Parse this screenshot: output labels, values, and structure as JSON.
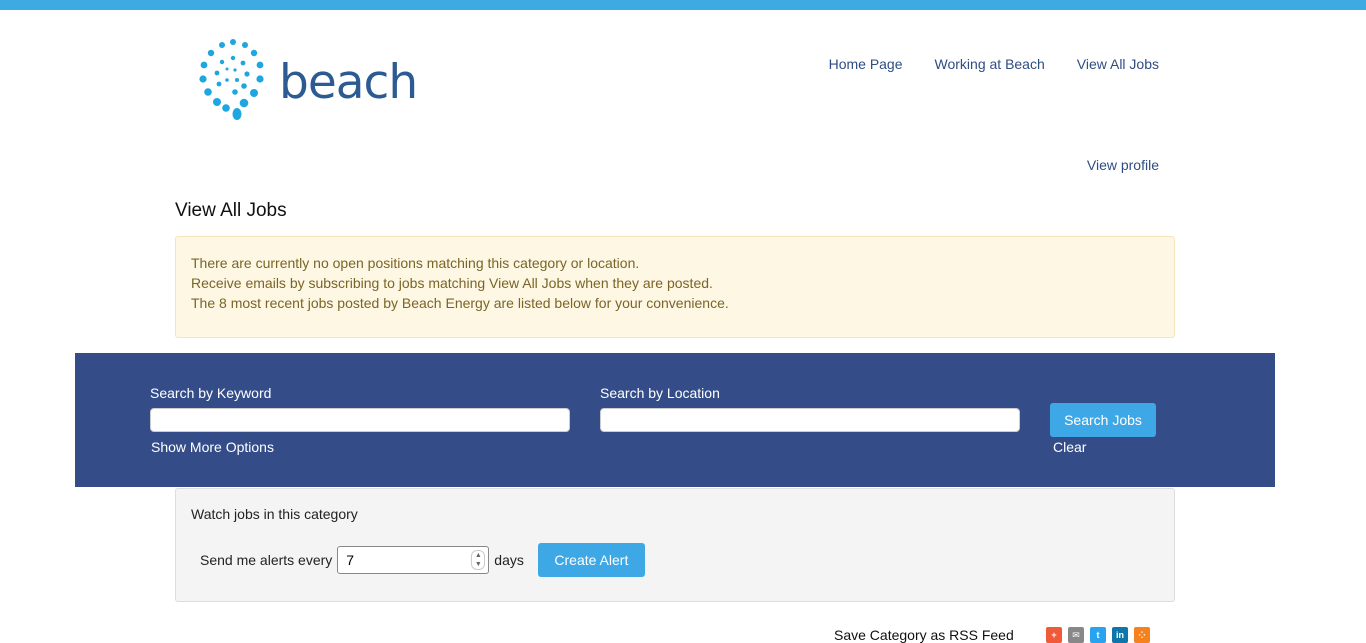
{
  "brand": {
    "name": "beach",
    "colors": {
      "top_bar": "#3daae4",
      "logo_text": "#2b5b92",
      "logo_mark": "#1da6e0",
      "search_band": "#344d89",
      "button": "#3da8e5",
      "notice_bg": "#fdf7e3",
      "notice_text": "#7a6528"
    }
  },
  "nav": {
    "items": [
      {
        "label": "Home Page"
      },
      {
        "label": "Working at Beach"
      },
      {
        "label": "View All Jobs"
      }
    ],
    "view_profile": "View profile"
  },
  "page": {
    "title": "View All Jobs",
    "notice_lines": [
      "There are currently no open positions matching this category or location.",
      "Receive emails by subscribing to jobs matching View All Jobs when they are posted.",
      "The 8 most recent jobs posted by Beach Energy are listed below for your convenience."
    ]
  },
  "search": {
    "keyword_label": "Search by Keyword",
    "keyword_value": "",
    "location_label": "Search by Location",
    "location_value": "",
    "show_more": "Show More Options",
    "button": "Search Jobs",
    "clear": "Clear"
  },
  "alerts": {
    "title": "Watch jobs in this category",
    "prefix": "Send me alerts every",
    "frequency": "7",
    "suffix": "days",
    "button": "Create Alert"
  },
  "footer": {
    "rss_label": "Save Category as RSS Feed",
    "share": [
      {
        "icon": "plus-share-icon",
        "color": "#f05a38"
      },
      {
        "icon": "email-icon",
        "color": "#888888"
      },
      {
        "icon": "twitter-icon",
        "color": "#2aa3ef"
      },
      {
        "icon": "linkedin-icon",
        "color": "#0e76a8"
      },
      {
        "icon": "rss-icon",
        "color": "#f5821f"
      }
    ]
  }
}
